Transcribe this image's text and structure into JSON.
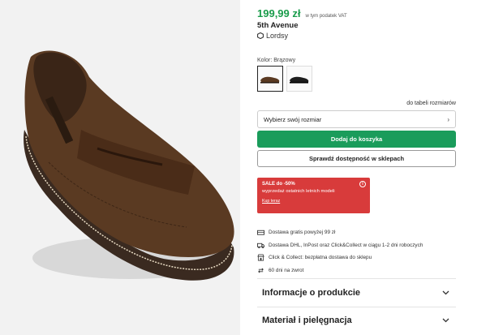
{
  "product": {
    "price": "199,99 zł",
    "vat_note": "w tym podatek VAT",
    "brand": "5th Avenue",
    "seller": "Lordsy"
  },
  "color": {
    "label": "Kolor: Brązowy",
    "swatches": [
      {
        "name": "brown",
        "selected": true,
        "hex": "#5a3a22"
      },
      {
        "name": "black",
        "selected": false,
        "hex": "#1c1c1c"
      }
    ]
  },
  "size": {
    "table_link": "do tabeli rozmiarów",
    "placeholder": "Wybierz swój rozmiar"
  },
  "buttons": {
    "add_to_cart": "Dodaj do koszyka",
    "check_store": "Sprawdź dostępność w sklepach"
  },
  "sale": {
    "title": "SALE do -50%",
    "subtitle": "wyprzedaż ostatnich letnich modeli",
    "link": "Kup teraz",
    "color": "#d83b3b"
  },
  "delivery": [
    {
      "icon": "van-icon",
      "text": "Dostawa gratis powyżej 99 zł"
    },
    {
      "icon": "truck-icon",
      "text": "Dostawa DHL, InPost oraz Click&Collect w ciągu 1-2 dni roboczych"
    },
    {
      "icon": "store-icon",
      "text": "Click & Collect: bezpłatna dostawa do sklepu"
    },
    {
      "icon": "return-icon",
      "text": "60 dni na zwrot"
    }
  ],
  "accordions": [
    {
      "label": "Informacje o produkcie"
    },
    {
      "label": "Materiał i pielęgnacja"
    }
  ],
  "accent": "#1a9c5b"
}
